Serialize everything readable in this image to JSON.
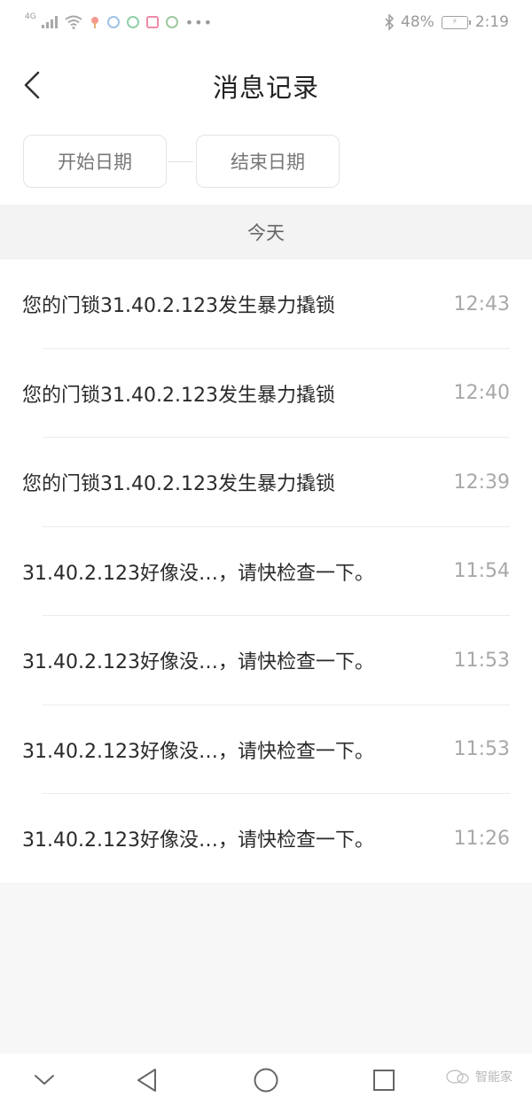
{
  "status_bar": {
    "network": "4G",
    "battery_percent": "48%",
    "time": "2:19",
    "icons": [
      "signal-icon",
      "wifi-icon",
      "location-icon",
      "app-icon",
      "app-icon",
      "app-icon",
      "app-icon",
      "more-icon",
      "bluetooth-icon",
      "battery-icon"
    ]
  },
  "header": {
    "title": "消息记录",
    "back_icon": "chevron-left-icon"
  },
  "filter": {
    "start_label": "开始日期",
    "end_label": "结束日期"
  },
  "section": {
    "label": "今天"
  },
  "messages": [
    {
      "text": "您的门锁31.40.2.123发生暴力撬锁",
      "time": "12:43"
    },
    {
      "text": "您的门锁31.40.2.123发生暴力撬锁",
      "time": "12:40"
    },
    {
      "text": "您的门锁31.40.2.123发生暴力撬锁",
      "time": "12:39"
    },
    {
      "text": "31.40.2.123好像没…，请快检查一下。",
      "time": "11:54"
    },
    {
      "text": "31.40.2.123好像没…，请快检查一下。",
      "time": "11:53"
    },
    {
      "text": "31.40.2.123好像没…，请快检查一下。",
      "time": "11:53"
    },
    {
      "text": "31.40.2.123好像没…，请快检查一下。",
      "time": "11:26"
    }
  ],
  "nav_bar": {
    "icons": [
      "chevron-down-icon",
      "triangle-back-icon",
      "circle-home-icon",
      "square-recent-icon"
    ],
    "watermark": "智能家"
  },
  "colors": {
    "background": "#f7f7f7",
    "surface": "#ffffff",
    "text_primary": "#2a2a2a",
    "text_secondary": "#a8a8a8"
  }
}
